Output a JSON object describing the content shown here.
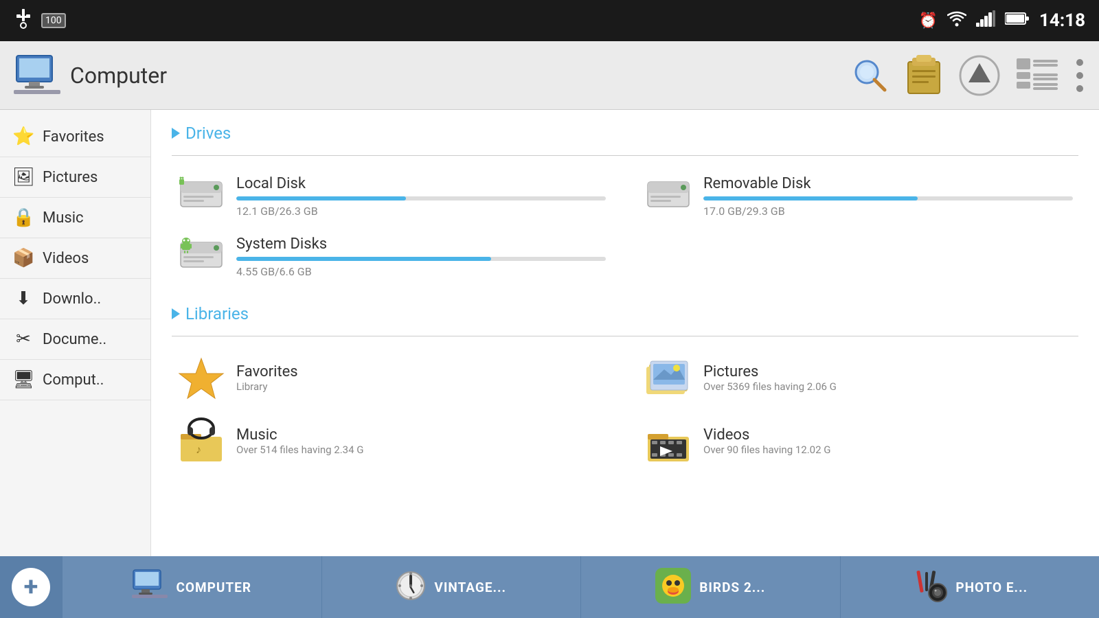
{
  "statusBar": {
    "time": "14:18",
    "batteryPercent": "100"
  },
  "header": {
    "title": "Computer"
  },
  "sidebar": {
    "items": [
      {
        "id": "favorites",
        "label": "Favorites",
        "icon": "⭐"
      },
      {
        "id": "pictures",
        "label": "Pictures",
        "icon": "🖼"
      },
      {
        "id": "music",
        "label": "Music",
        "icon": "🔒"
      },
      {
        "id": "videos",
        "label": "Videos",
        "icon": "📦"
      },
      {
        "id": "downloads",
        "label": "Downlo..",
        "icon": "⬇"
      },
      {
        "id": "documents",
        "label": "Docume..",
        "icon": "✂"
      },
      {
        "id": "computer",
        "label": "Comput..",
        "icon": "🖥"
      }
    ]
  },
  "drives": {
    "sectionLabel": "Drives",
    "items": [
      {
        "id": "local-disk",
        "name": "Local Disk",
        "used": "12.1 GB",
        "total": "26.3 GB",
        "label": "12.1 GB/26.3 GB",
        "fillPercent": 46
      },
      {
        "id": "removable-disk",
        "name": "Removable Disk",
        "used": "17.0 GB",
        "total": "29.3 GB",
        "label": "17.0 GB/29.3 GB",
        "fillPercent": 58
      },
      {
        "id": "system-disks",
        "name": "System Disks",
        "used": "4.55 GB",
        "total": "6.6 GB",
        "label": "4.55 GB/6.6 GB",
        "fillPercent": 69
      }
    ]
  },
  "libraries": {
    "sectionLabel": "Libraries",
    "items": [
      {
        "id": "favorites",
        "name": "Favorites",
        "desc": "Library"
      },
      {
        "id": "pictures",
        "name": "Pictures",
        "desc": "Over 5369 files having 2.06 G"
      },
      {
        "id": "music",
        "name": "Music",
        "desc": "Over 514 files having 2.34 G"
      },
      {
        "id": "videos",
        "name": "Videos",
        "desc": "Over 90 files having 12.02 G"
      }
    ]
  },
  "taskbar": {
    "addLabel": "+",
    "items": [
      {
        "id": "computer",
        "label": "COMPUTER"
      },
      {
        "id": "vintage",
        "label": "VINTAGE..."
      },
      {
        "id": "birds2",
        "label": "BIRDS 2..."
      },
      {
        "id": "photoe",
        "label": "PHOTO E..."
      }
    ]
  }
}
